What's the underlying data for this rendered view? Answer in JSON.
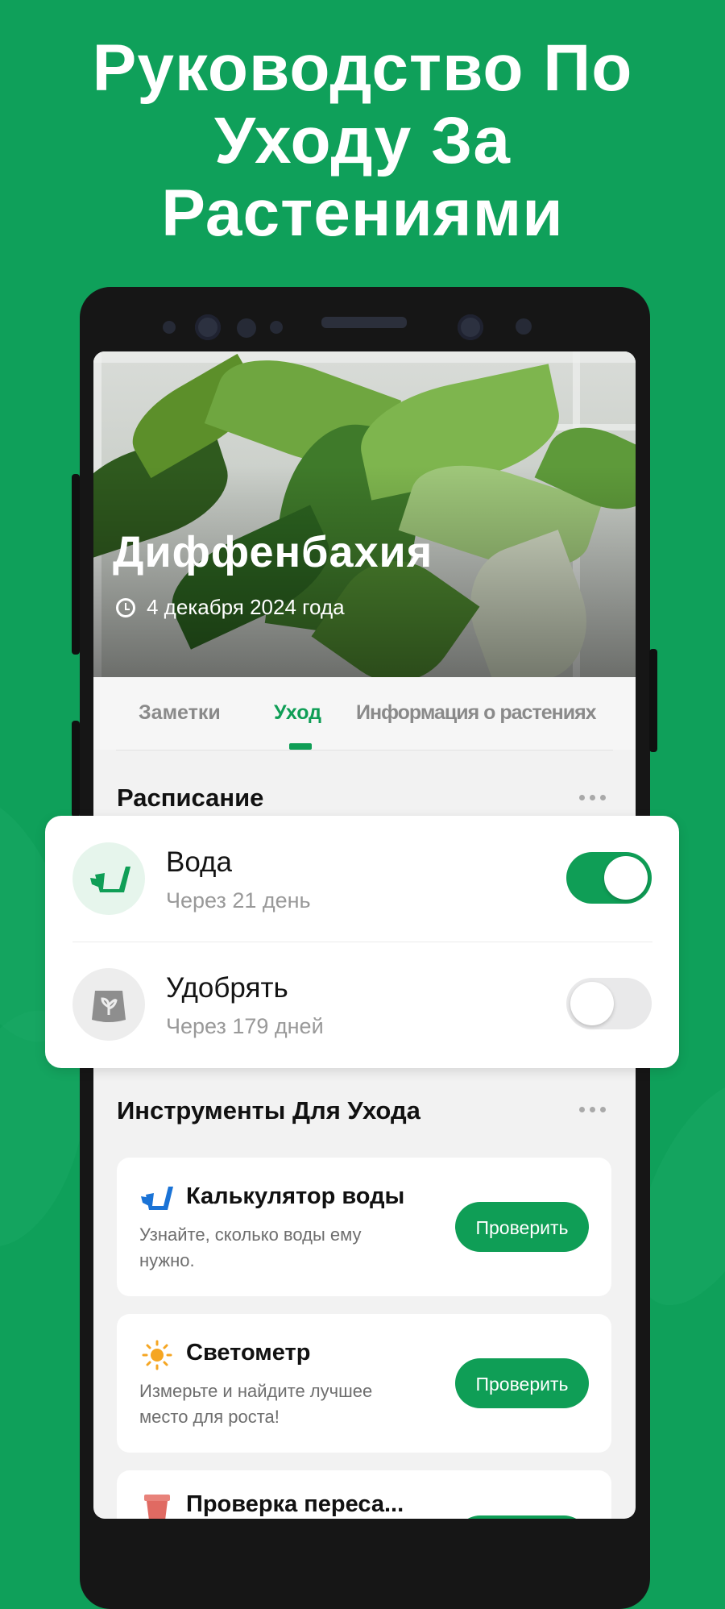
{
  "headline": {
    "line1": "Руководство По",
    "line2": "Уходу За",
    "line3": "Растениями"
  },
  "plant": {
    "name": "Диффенбахия",
    "date": "4 декабря 2024 года"
  },
  "tabs": [
    {
      "label": "Заметки",
      "active": false
    },
    {
      "label": "Уход",
      "active": true
    },
    {
      "label": "Информация о растениях",
      "active": false
    }
  ],
  "schedule": {
    "title": "Расписание",
    "items": [
      {
        "name": "Вода",
        "due": "Через 21 день",
        "enabled": true,
        "icon": "watering-can-icon"
      },
      {
        "name": "Удобрять",
        "due": "Через 179 дней",
        "enabled": false,
        "icon": "fertilizer-bag-icon"
      }
    ]
  },
  "care_tools": {
    "title": "Инструменты Для Ухода",
    "items": [
      {
        "name": "Калькулятор воды",
        "description": "Узнайте, сколько воды ему нужно.",
        "button": "Проверить",
        "icon": "watering-can-icon"
      },
      {
        "name": "Светометр",
        "description": "Измерьте и найдите лучшее место для роста!",
        "button": "Проверить",
        "icon": "sun-icon"
      },
      {
        "name": "Проверка переса...",
        "description": "",
        "button": "",
        "icon": "pot-icon"
      }
    ]
  },
  "colors": {
    "brand_green": "#0f9e56",
    "background": "#0fa05a"
  }
}
